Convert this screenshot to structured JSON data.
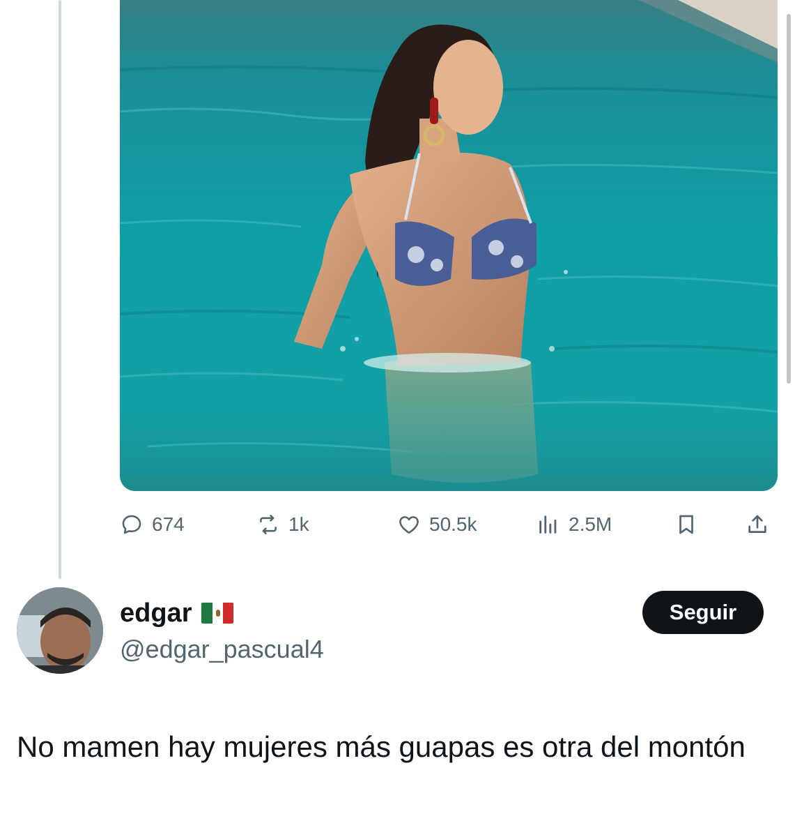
{
  "main_post": {
    "media": {
      "alt": ""
    },
    "actions": {
      "replies": "674",
      "reposts": "1k",
      "likes": "50.5k",
      "views": "2.5M",
      "icons": [
        "reply-icon",
        "repost-icon",
        "like-icon",
        "views-icon",
        "bookmark-icon",
        "share-icon"
      ]
    }
  },
  "reply": {
    "display_name": "edgar",
    "flag": "mexico-flag",
    "handle": "@edgar_pascual4",
    "follow_label": "Seguir",
    "text": "No mamen hay mujeres más guapas es otra del montón"
  },
  "colors": {
    "text_primary": "#0f1419",
    "text_secondary": "#536471",
    "thread_line": "#cfd9de",
    "button_bg": "#0f1419",
    "button_text": "#ffffff",
    "pool_water": "#149ea5"
  }
}
